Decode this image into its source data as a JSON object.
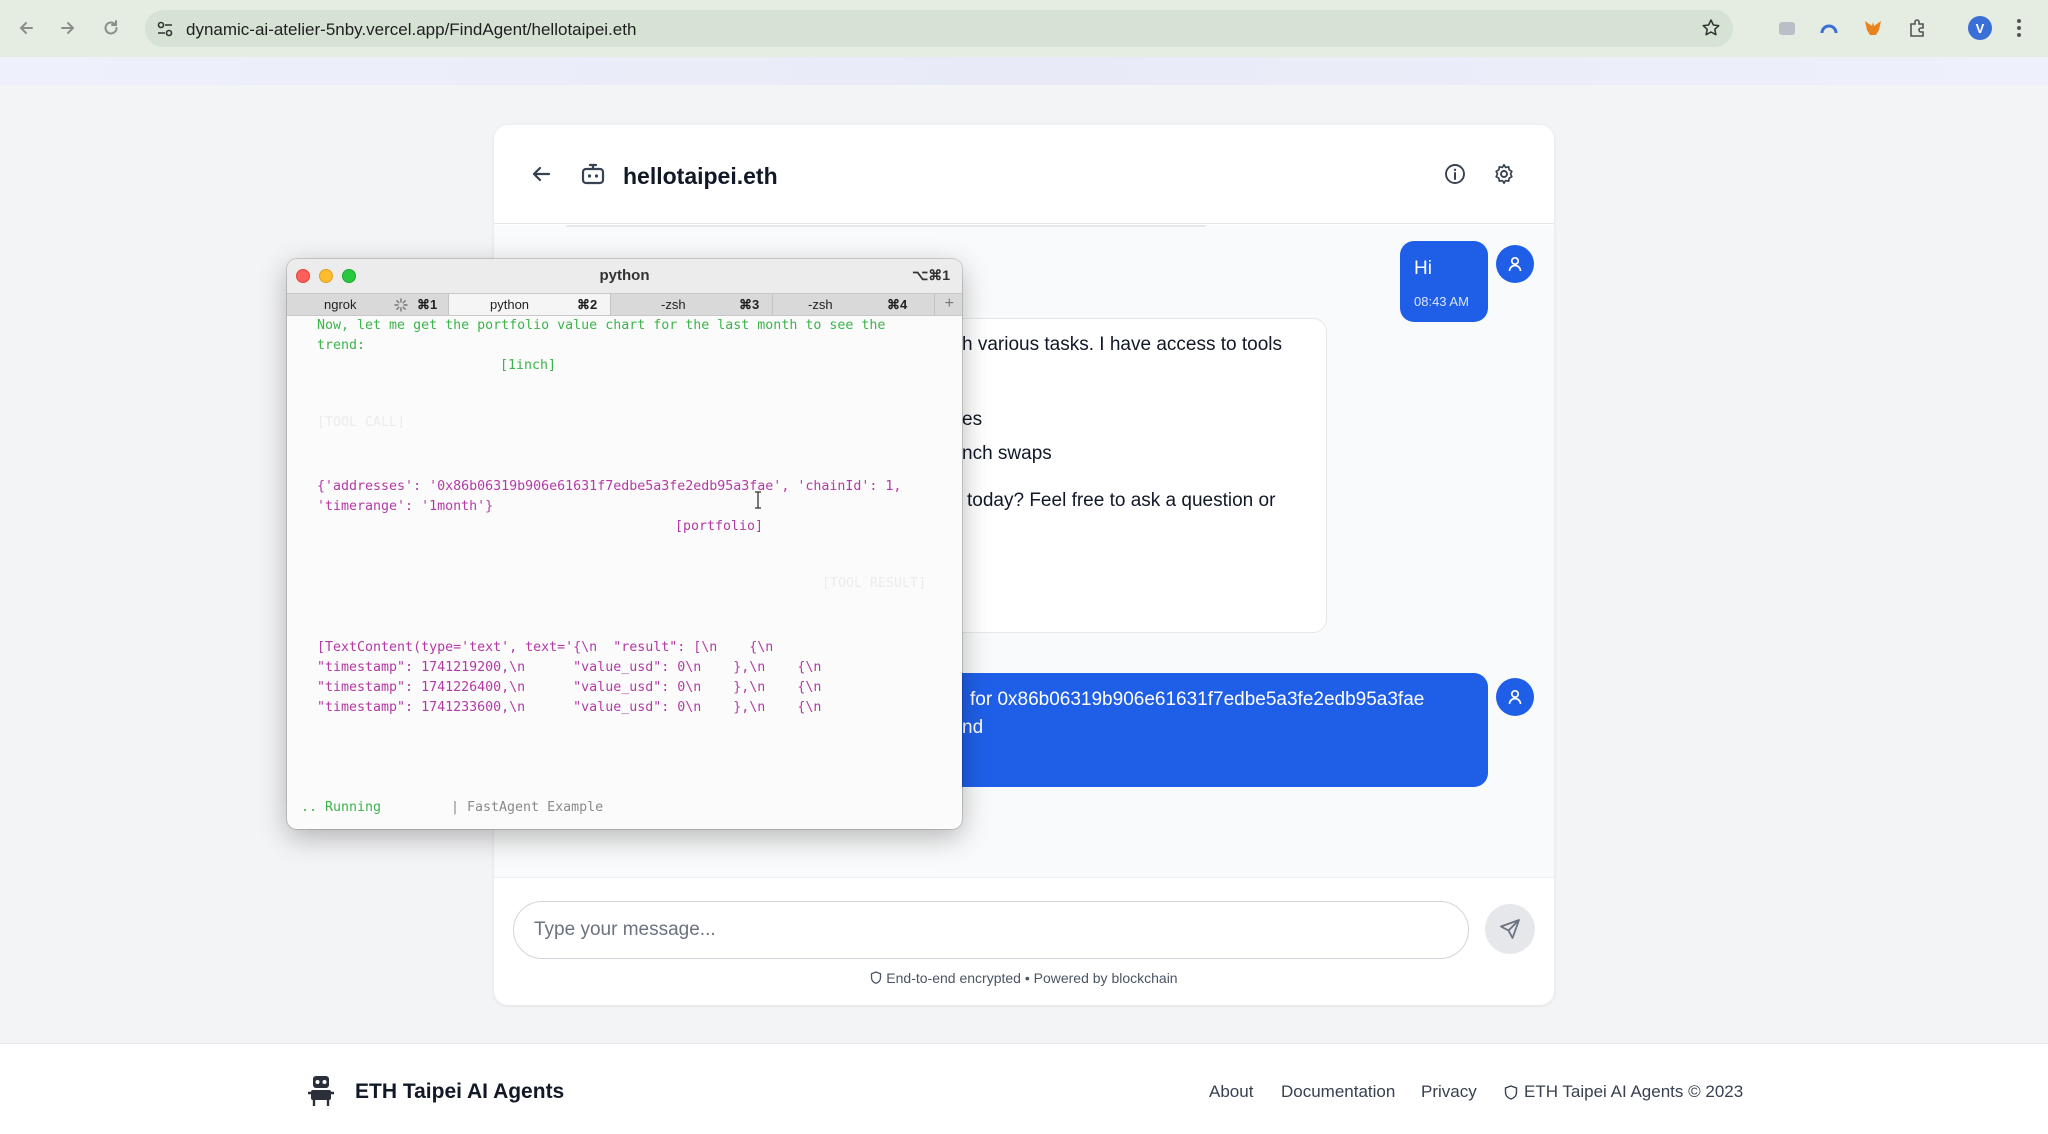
{
  "browser": {
    "url_host": "dynamic-ai-atelier-5nby.vercel.app",
    "url_path": "/FindAgent/hellotaipei.eth",
    "profile_initial": "V"
  },
  "chat": {
    "agent_name": "hellotaipei.eth",
    "messages": [
      {
        "role": "user",
        "text": "Hi",
        "time": "08:43 AM"
      },
      {
        "role": "bot",
        "lines": [
          "h various tasks. I have access to tools",
          "",
          "",
          "es",
          "nch swaps",
          "",
          "today? Feel free to ask a question or"
        ]
      },
      {
        "role": "user",
        "lines": [
          "for 0x86b06319b906e61631f7edbe5a3fe2edb95a3fae",
          "nd"
        ]
      }
    ],
    "input_placeholder": "Type your message...",
    "footnote": "End-to-end encrypted • Powered by blockchain"
  },
  "terminal": {
    "title": "python",
    "shortcut": "⌥⌘1",
    "tabs": [
      {
        "name": "ngrok",
        "key": "⌘1"
      },
      {
        "name": "python",
        "key": "⌘2"
      },
      {
        "name": "-zsh",
        "key": "⌘3"
      },
      {
        "name": "-zsh",
        "key": "⌘4"
      }
    ],
    "lines": {
      "l1": "Now, let me get the portfolio value chart for the last month to see the",
      "l2": "trend:",
      "tag1": "[1inch]",
      "faint1": "[TOOL CALL]",
      "call1": "{'addresses': '0x86b06319b906e61631f7edbe5a3fe2edb95a3fae', 'chainId': 1,",
      "call2": "'timerange': '1month'}",
      "tag2": "[portfolio]",
      "faint2": "[TOOL RESULT]",
      "r1": "[TextContent(type='text', text='{\\n  \"result\": [\\n    {\\n",
      "r2": "\"timestamp\": 1741219200,\\n      \"value_usd\": 0\\n    },\\n    {\\n",
      "r3": "\"timestamp\": 1741226400,\\n      \"value_usd\": 0\\n    },\\n    {\\n",
      "r4": "\"timestamp\": 1741233600,\\n      \"value_usd\": 0\\n    },\\n    {\\n",
      "status_running": ".. Running",
      "status_app": "| FastAgent Example"
    }
  },
  "footer": {
    "brand": "ETH Taipei AI Agents",
    "links": [
      "About",
      "Documentation",
      "Privacy"
    ],
    "copyright": "ETH Taipei AI Agents © 2023"
  }
}
